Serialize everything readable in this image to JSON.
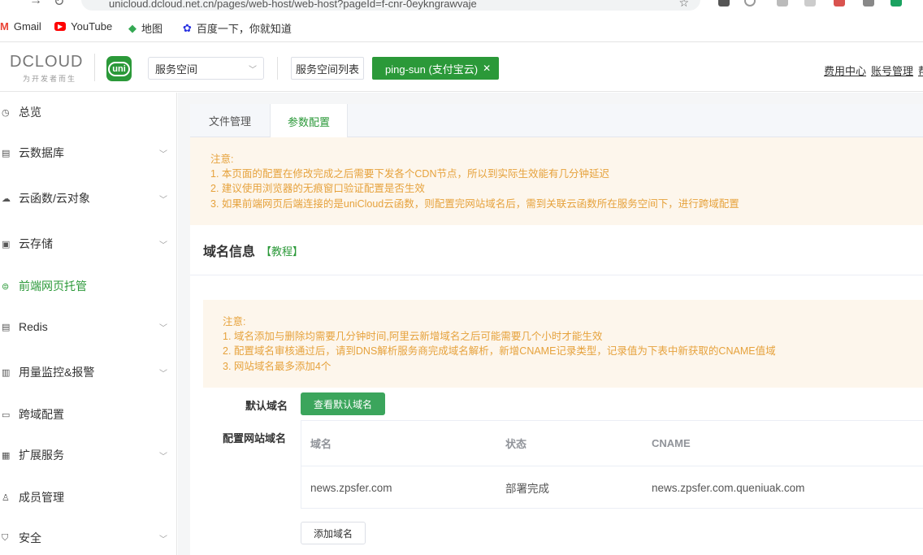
{
  "browser": {
    "url": "unicloud.dcloud.net.cn/pages/web-host/web-host?pageId=f-cnr-0eykngrawvaje",
    "bookmarks": [
      {
        "label": "Gmail",
        "icon": "gmail-icon"
      },
      {
        "label": "YouTube",
        "icon": "youtube-icon"
      },
      {
        "label": "地图",
        "icon": "maps-icon"
      },
      {
        "label": "百度一下，你就知道",
        "icon": "baidu-icon"
      }
    ]
  },
  "header": {
    "logo_text": "DCLOUD",
    "logo_sub": "为开发者而生",
    "uni_badge": "uni",
    "space_select": "服务空间",
    "space_list_button": "服务空间列表",
    "space_tag": "ping-sun (支付宝云)",
    "links": [
      "费用中心",
      "账号管理",
      "帮"
    ]
  },
  "sidebar": {
    "items": [
      {
        "label": "总览",
        "icon": "clock-icon",
        "chevron": false
      },
      {
        "label": "云数据库",
        "icon": "database-icon",
        "chevron": true
      },
      {
        "label": "云函数/云对象",
        "icon": "cloud-icon",
        "chevron": true
      },
      {
        "label": "云存储",
        "icon": "storage-icon",
        "chevron": true
      },
      {
        "label": "前端网页托管",
        "icon": "web-icon",
        "chevron": false,
        "active": true
      },
      {
        "label": "Redis",
        "icon": "redis-icon",
        "chevron": true
      },
      {
        "label": "用量监控&报警",
        "icon": "monitor-icon",
        "chevron": true
      },
      {
        "label": "跨域配置",
        "icon": "cross-domain-icon",
        "chevron": false
      },
      {
        "label": "扩展服务",
        "icon": "grid-icon",
        "chevron": true
      },
      {
        "label": "成员管理",
        "icon": "user-icon",
        "chevron": false
      },
      {
        "label": "安全",
        "icon": "shield-icon",
        "chevron": true
      }
    ]
  },
  "tabs": [
    "文件管理",
    "参数配置"
  ],
  "notice1": [
    "注意:",
    "1. 本页面的配置在修改完成之后需要下发各个CDN节点，所以到实际生效能有几分钟延迟",
    "2. 建议使用浏览器的无痕窗口验证配置是否生效",
    "3. 如果前端网页后端连接的是uniCloud云函数，则配置完网站域名后，需到关联云函数所在服务空间下，进行跨域配置"
  ],
  "section": {
    "title": "域名信息",
    "tutorial_link": "【教程】"
  },
  "notice2": [
    "注意:",
    "1. 域名添加与删除均需要几分钟时间,阿里云新增域名之后可能需要几个小时才能生效",
    "2. 配置域名审核通过后，请到DNS解析服务商完成域名解析，新增CNAME记录类型，记录值为下表中新获取的CNAME值域",
    "3. 网站域名最多添加4个"
  ],
  "form": {
    "default_domain_label": "默认域名",
    "view_default_button": "查看默认域名",
    "site_domain_label": "配置网站域名",
    "table_headers": [
      "域名",
      "状态",
      "CNAME"
    ],
    "rows": [
      {
        "domain": "news.zpsfer.com",
        "status": "部署完成",
        "cname": "news.zpsfer.com.queniuak.com"
      }
    ],
    "add_button": "添加域名"
  },
  "colors": {
    "brand_green": "#2b9939",
    "notice_bg": "#fdf6ec",
    "notice_text": "#e6a23c"
  }
}
